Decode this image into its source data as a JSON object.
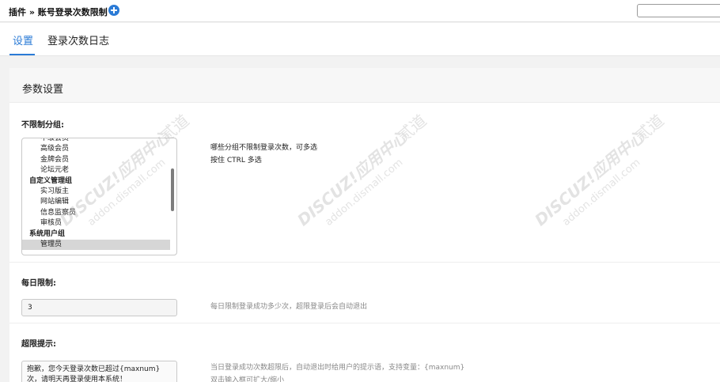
{
  "header": {
    "breadcrumb": "插件 » 账号登录次数限制"
  },
  "tabs": [
    {
      "label": "设置",
      "active": true
    },
    {
      "label": "登录次数日志",
      "active": false
    }
  ],
  "panel": {
    "title": "参数设置"
  },
  "fields": {
    "groups": {
      "label": "不限制分组:",
      "options": [
        {
          "label": "中级会员",
          "group": false,
          "selected": false
        },
        {
          "label": "高级会员",
          "group": false,
          "selected": false
        },
        {
          "label": "金牌会员",
          "group": false,
          "selected": false
        },
        {
          "label": "论坛元老",
          "group": false,
          "selected": false
        },
        {
          "label": "自定义管理组",
          "group": true,
          "selected": false
        },
        {
          "label": "实习版主",
          "group": false,
          "selected": false
        },
        {
          "label": "网站编辑",
          "group": false,
          "selected": false
        },
        {
          "label": "信息监察员",
          "group": false,
          "selected": false
        },
        {
          "label": "审核员",
          "group": false,
          "selected": false
        },
        {
          "label": "系统用户组",
          "group": true,
          "selected": false
        },
        {
          "label": "管理员",
          "group": false,
          "selected": true
        }
      ],
      "hint_line1": "哪些分组不限制登录次数，可多选",
      "hint_line2": "按住 CTRL 多选"
    },
    "daily_limit": {
      "label": "每日限制:",
      "value": "3",
      "hint": "每日限制登录成功多少次，超限登录后会自动退出"
    },
    "over_limit": {
      "label": "超限提示:",
      "value_line1": "抱歉，您今天登录次数已超过{maxnum}",
      "value_line2": "次，请明天再登录使用本系统！",
      "hint_line1": "当日登录成功次数超限后，自动退出时给用户的提示语，支持变量：{maxnum}",
      "hint_line2": "双击输入框可扩大/缩小"
    }
  },
  "watermark": {
    "brand": "DISCUZ!应用中心",
    "sub": "addon.dismall.com",
    "mark": "贰道"
  },
  "colors": {
    "accent": "#2b7bd6"
  }
}
